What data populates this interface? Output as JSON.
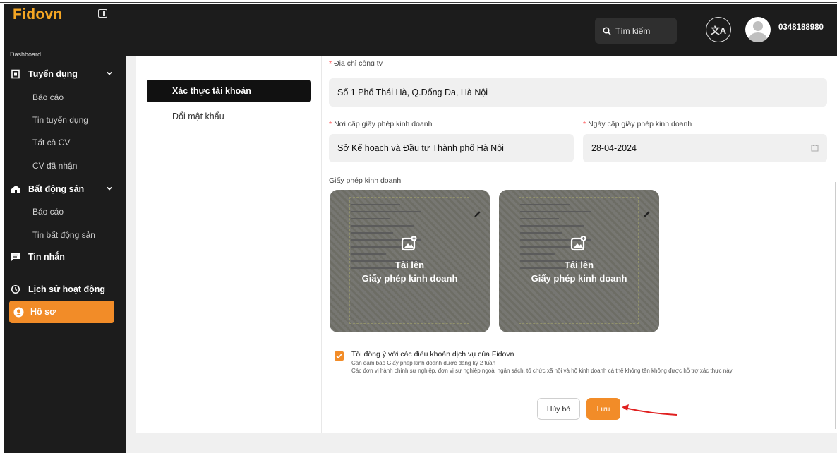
{
  "header": {
    "logo": "Fidovn",
    "search_placeholder": "Tìm kiếm",
    "translate_glyph": "文A",
    "phone": "0348188980"
  },
  "sidebar": {
    "section_label": "Dashboard",
    "groups": [
      {
        "label": "Tuyển dụng",
        "icon": "badge-icon",
        "items": [
          "Báo cáo",
          "Tin tuyển dụng",
          "Tất cả CV",
          "CV đã nhận"
        ]
      },
      {
        "label": "Bất động sản",
        "icon": "house-icon",
        "items": [
          "Báo cáo",
          "Tin bất động sản"
        ]
      },
      {
        "label": "Tin nhắn",
        "icon": "message-icon",
        "items": []
      }
    ],
    "history": "Lịch sử hoạt động",
    "profile": "Hồ sơ"
  },
  "settings_menu": {
    "active": "Xác thực tài khoản",
    "other": "Đổi mật khẩu"
  },
  "form": {
    "address_label": "Địa chỉ công ty",
    "address_value": "Số 1 Phố Thái Hà, Q.Đống Đa, Hà Nội",
    "issuer_label": "Nơi cấp giấy phép kinh doanh",
    "issuer_value": "Sở Kế hoạch và Đầu tư Thành phố Hà Nội",
    "date_label": "Ngày cấp giấy phép kinh doanh",
    "date_value": "28-04-2024",
    "license_label": "Giấy phép kinh doanh",
    "upload_line1": "Tải lên",
    "upload_line2": "Giấy phép kinh doanh",
    "agree_title": "Tôi đồng ý với các điều khoản dịch vụ của Fidovn",
    "agree_line1": "Cần đảm bảo Giấy phép kinh doanh được đăng ký 2 tuần",
    "agree_line2": "Các đơn vị hành chính sự nghiệp, đơn vị sự nghiệp ngoài ngân sách, tổ chức xã hội và hộ kinh doanh cá thể không tên không được hỗ trợ xác thực này",
    "agree_checked": true,
    "cancel_label": "Hủy bỏ",
    "save_label": "Lưu"
  },
  "colors": {
    "accent": "#f28c28",
    "sidebar_bg": "#1c1c1c",
    "required": "#ff4d4f",
    "arrow": "#e02020"
  }
}
